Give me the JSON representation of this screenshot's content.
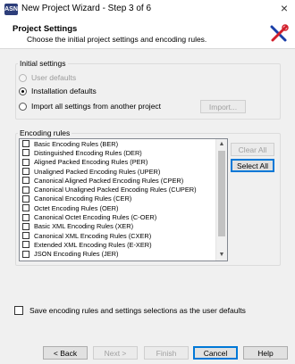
{
  "window": {
    "icon_text": "ASN",
    "title": "New Project Wizard - Step 3 of 6",
    "close_symbol": "×"
  },
  "header": {
    "title": "Project Settings",
    "subtitle": "Choose the initial project settings and encoding rules."
  },
  "initial_settings": {
    "legend": "Initial settings",
    "options": [
      {
        "label": "User defaults",
        "checked": false,
        "disabled": true
      },
      {
        "label": "Installation defaults",
        "checked": true,
        "disabled": false
      },
      {
        "label": "Import all settings from another project",
        "checked": false,
        "disabled": false
      }
    ],
    "import_button": "Import..."
  },
  "encoding_rules": {
    "legend": "Encoding rules",
    "items": [
      {
        "label": "Basic Encoding Rules (BER)",
        "checked": false
      },
      {
        "label": "Distinguished Encoding Rules (DER)",
        "checked": false
      },
      {
        "label": "Aligned Packed Encoding Rules (PER)",
        "checked": false
      },
      {
        "label": "Unaligned Packed Encoding Rules (UPER)",
        "checked": false
      },
      {
        "label": "Canonical Aligned Packed Encoding Rules (CPER)",
        "checked": false
      },
      {
        "label": "Canonical Unaligned Packed Encoding Rules (CUPER)",
        "checked": false
      },
      {
        "label": "Canonical Encoding Rules (CER)",
        "checked": false
      },
      {
        "label": "Octet Encoding Rules (OER)",
        "checked": false
      },
      {
        "label": "Canonical Octet Encoding Rules (C-OER)",
        "checked": false
      },
      {
        "label": "Basic XML Encoding Rules (XER)",
        "checked": false
      },
      {
        "label": "Canonical XML Encoding Rules (CXER)",
        "checked": false
      },
      {
        "label": "Extended XML Encoding Rules (E-XER)",
        "checked": false
      },
      {
        "label": "JSON Encoding Rules (JER)",
        "checked": false
      }
    ],
    "clear_all": "Clear All",
    "select_all": "Select All"
  },
  "save_defaults": {
    "label": "Save encoding rules and settings selections as the user defaults",
    "checked": false
  },
  "footer": {
    "back": "< Back",
    "next": "Next >",
    "finish": "Finish",
    "cancel": "Cancel",
    "help": "Help"
  }
}
